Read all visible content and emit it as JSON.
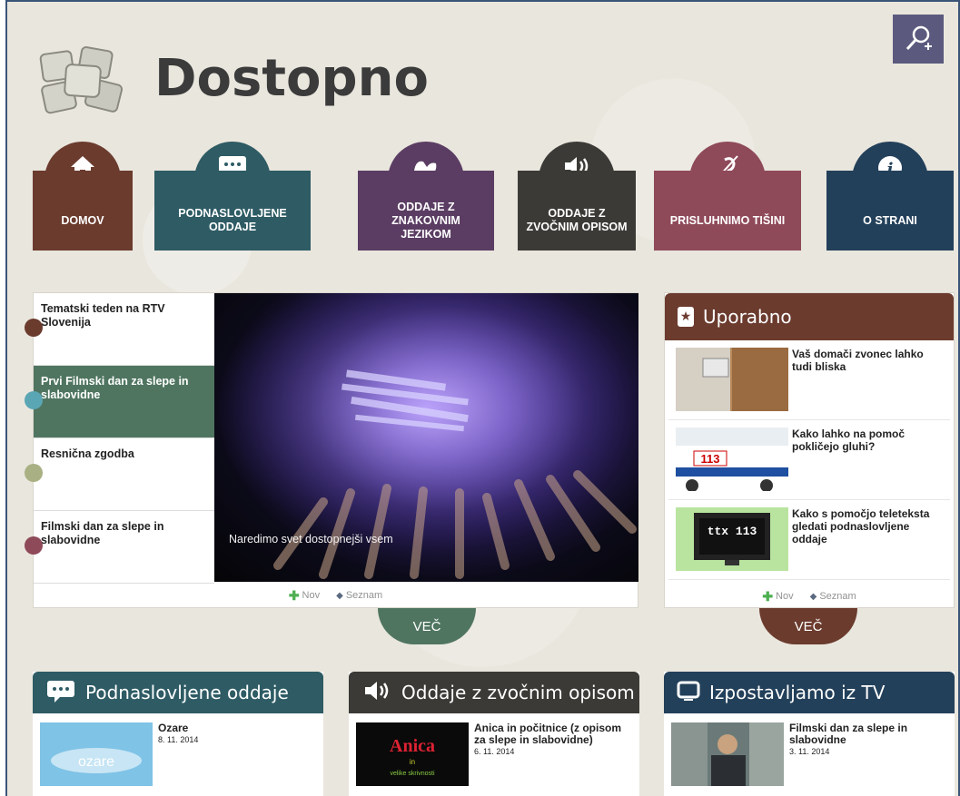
{
  "site": {
    "title": "Dostopno"
  },
  "nav": [
    {
      "label": "DOMOV",
      "color": "#6b3b2e",
      "icon": "home-icon"
    },
    {
      "label": "PODNASLOVLJENE ODDAJE",
      "color": "#2e5b64",
      "icon": "subtitles-icon"
    },
    {
      "label": "ODDAJE Z ZNAKOVNIM JEZIKOM",
      "color": "#5b3d63",
      "icon": "sign-language-icon"
    },
    {
      "label": "ODDAJE Z ZVOČNIM OPISOM",
      "color": "#3c3a36",
      "icon": "audio-description-icon"
    },
    {
      "label": "PRISLUHNIMO TIŠINI",
      "color": "#8f4a5a",
      "icon": "hearing-icon"
    },
    {
      "label": "O STRANI",
      "color": "#23405a",
      "icon": "info-icon"
    }
  ],
  "slider": {
    "items": [
      {
        "label": "Tematski teden na RTV Slovenija"
      },
      {
        "label": "Prvi Filmski dan za slepe in slabovidne"
      },
      {
        "label": "Resnična zgodba"
      },
      {
        "label": "Filmski dan za slepe in slabovidne"
      }
    ],
    "caption": "Naredimo svet dostopnejši vsem",
    "footer_new": "Nov",
    "footer_list": "Seznam",
    "more": "VEČ"
  },
  "uporabno": {
    "title": "Uporabno",
    "items": [
      {
        "title": "Vaš domači zvonec lahko tudi bliska"
      },
      {
        "title": "Kako lahko na pomoč pokličejo gluhi?",
        "thumb_text": "113"
      },
      {
        "title": "Kako s pomočjo teleteksta gledati podnaslovljene oddaje",
        "thumb_text": "ttx 113"
      }
    ],
    "footer_new": "Nov",
    "footer_list": "Seznam",
    "more": "VEČ"
  },
  "columns": [
    {
      "title": "Podnaslovljene oddaje",
      "color": "#2e5b64",
      "icon": "subtitles-icon",
      "item": {
        "title": "Ozare",
        "date": "8. 11. 2014",
        "thumb_text": "ozare"
      }
    },
    {
      "title": "Oddaje z zvočnim opisom",
      "color": "#3c3a36",
      "icon": "audio-description-icon",
      "item": {
        "title": "Anica in počitnice (z opisom za slepe in slabovidne)",
        "date": "6. 11. 2014",
        "thumb_text": "Anica"
      }
    },
    {
      "title": "Izpostavljamo iz TV",
      "color": "#23405a",
      "icon": "tv-icon",
      "item": {
        "title": "Filmski dan za slepe in slabovidne",
        "date": "3. 11. 2014"
      }
    }
  ],
  "colors": {
    "accent_green": "#4f7560",
    "accent_brown": "#6b3b2e",
    "zoom": "#5b5a7e"
  }
}
